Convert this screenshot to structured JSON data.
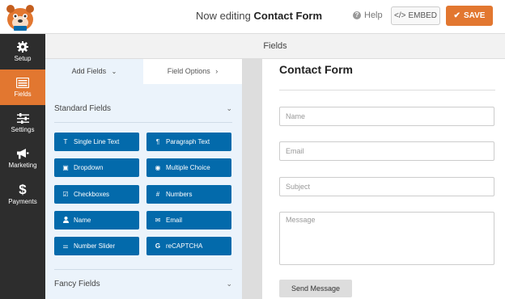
{
  "header": {
    "editing_prefix": "Now editing",
    "form_name": "Contact Form",
    "help_label": "Help",
    "embed_label": "EMBED",
    "save_label": "SAVE"
  },
  "sidebar": {
    "items": [
      {
        "label": "Setup",
        "icon": "gear-icon"
      },
      {
        "label": "Fields",
        "icon": "fields-icon",
        "active": true
      },
      {
        "label": "Settings",
        "icon": "sliders-icon"
      },
      {
        "label": "Marketing",
        "icon": "megaphone-icon"
      },
      {
        "label": "Payments",
        "icon": "dollar-icon"
      }
    ]
  },
  "fields_bar": {
    "title": "Fields"
  },
  "panel": {
    "tabs": [
      {
        "label": "Add Fields"
      },
      {
        "label": "Field Options"
      }
    ],
    "standard_section": "Standard Fields",
    "fancy_section": "Fancy Fields",
    "standard_fields": [
      {
        "label": "Single Line Text",
        "icon": "T"
      },
      {
        "label": "Paragraph Text",
        "icon": "¶"
      },
      {
        "label": "Dropdown",
        "icon": "▣"
      },
      {
        "label": "Multiple Choice",
        "icon": "◉"
      },
      {
        "label": "Checkboxes",
        "icon": "☑"
      },
      {
        "label": "Numbers",
        "icon": "#"
      },
      {
        "label": "Name",
        "icon": "👤"
      },
      {
        "label": "Email",
        "icon": "✉"
      },
      {
        "label": "Number Slider",
        "icon": "⚌"
      },
      {
        "label": "reCAPTCHA",
        "icon": "G"
      }
    ]
  },
  "preview": {
    "form_title": "Contact Form",
    "fields": [
      {
        "placeholder": "Name"
      },
      {
        "placeholder": "Email"
      },
      {
        "placeholder": "Subject"
      }
    ],
    "message_placeholder": "Message",
    "submit_label": "Send Message"
  },
  "colors": {
    "accent": "#e27730",
    "sidebar": "#2d2d2d",
    "field_button": "#036aab",
    "panel_bg": "#ebf3fb"
  }
}
